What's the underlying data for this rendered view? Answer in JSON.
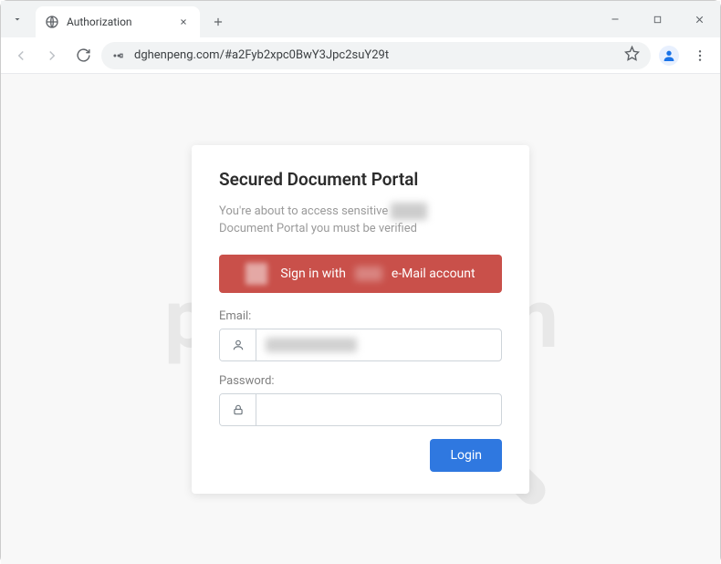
{
  "browser": {
    "tab_title": "Authorization",
    "url": "dghenpeng.com/#a2Fyb2xpc0BwY3Jpc2suY29t"
  },
  "card": {
    "title": "Secured Document Portal",
    "subtitle_line1_prefix": "You're about to access sensitive ",
    "subtitle_line2": "Document Portal you must be verified",
    "signin_prefix": "Sign in with ",
    "signin_suffix": " e-Mail account",
    "email_label": "Email:",
    "password_label": "Password:",
    "login_button": "Login"
  },
  "watermark": {
    "text": "pcrisk.com"
  }
}
